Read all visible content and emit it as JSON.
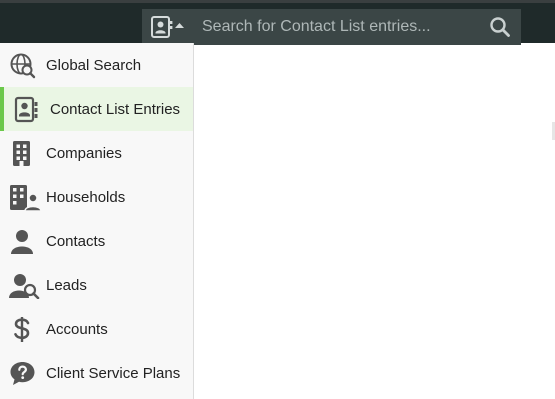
{
  "search": {
    "placeholder": "Search for Contact List entries...",
    "scope_icon": "contact-list-icon"
  },
  "sidebar": {
    "items": [
      {
        "label": "Global Search",
        "icon": "globe-search-icon",
        "active": false
      },
      {
        "label": "Contact List Entries",
        "icon": "contact-list-icon",
        "active": true
      },
      {
        "label": "Companies",
        "icon": "building-icon",
        "active": false
      },
      {
        "label": "Households",
        "icon": "household-icon",
        "active": false
      },
      {
        "label": "Contacts",
        "icon": "person-icon",
        "active": false
      },
      {
        "label": "Leads",
        "icon": "person-search-icon",
        "active": false
      },
      {
        "label": "Accounts",
        "icon": "dollar-icon",
        "active": false
      },
      {
        "label": "Client Service Plans",
        "icon": "help-chat-icon",
        "active": false
      }
    ]
  },
  "colors": {
    "topbar": "#1f2a2a",
    "search_bg": "#3b4646",
    "active_bg": "#eaf6e4",
    "active_accent": "#6bc84a",
    "icon": "#555555"
  }
}
